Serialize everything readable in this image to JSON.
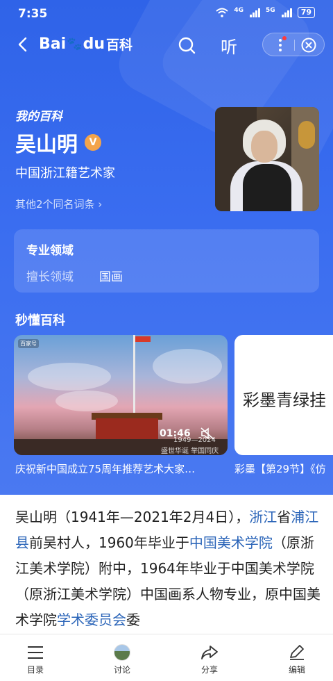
{
  "status_bar": {
    "time": "7:35",
    "net1": "4G",
    "net2": "5G",
    "battery": "79"
  },
  "nav": {
    "logo_text": "Bai",
    "logo_mid": "du",
    "logo_suffix": "百科",
    "listen_label": "听"
  },
  "entry": {
    "section_label": "我的百科",
    "title": "吴山明",
    "verified_badge": "V",
    "subtitle": "中国浙江籍艺术家",
    "same_name_link": "其他2个同名词条 ›"
  },
  "field_card": {
    "heading": "专业领域",
    "key": "擅长领域",
    "value": "国画"
  },
  "videos": {
    "section_title": "秒懂百科",
    "items": [
      {
        "caption": "庆祝新中国成立75周年推荐艺术大家…",
        "duration": "01:46",
        "overlay1": "1949—2024",
        "overlay2": "盛世华诞 举国同庆",
        "badge": "百家号"
      },
      {
        "caption": "彩墨【第29节】《仿",
        "cover_text": "彩墨青绿挂"
      }
    ]
  },
  "article": {
    "p1": "吴山明（1941年—2021年2月4日），",
    "l1": "浙江",
    "p2": "省",
    "l2": "浦江县",
    "p3": "前吴村人，1960年毕业于",
    "l3": "中国美术学院",
    "p4": "（原浙江美术学院）附中，1964年毕业于中国美术学院（原浙江美术学院）中国画系人物专业，原中国美术学院",
    "l4": "学术委员会",
    "p5": "委"
  },
  "bottom_bar": {
    "toc": "目录",
    "discuss": "讨论",
    "share": "分享",
    "edit": "编辑"
  },
  "colors": {
    "hero_blue": "#3a6df0",
    "link_blue": "#2a64b8",
    "verified_orange": "#f3a44b"
  }
}
